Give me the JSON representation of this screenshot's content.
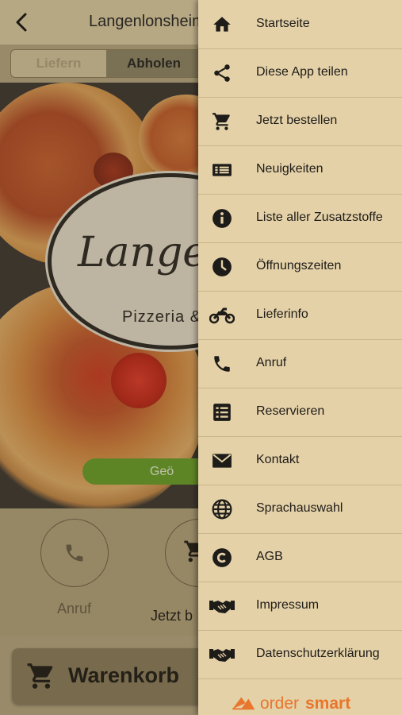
{
  "header": {
    "title": "Langenlonsheim"
  },
  "segment": {
    "deliver_label": "Liefern",
    "pickup_label": "Abholen"
  },
  "hero": {
    "logo_script": "Langen",
    "logo_subtitle": "Pizzeria &",
    "open_button_label": "Geö"
  },
  "actions": {
    "call_label": "Anruf",
    "order_label": "Jetzt b"
  },
  "cart": {
    "label": "Warenkorb"
  },
  "menu": {
    "items": [
      {
        "label": "Startseite",
        "icon": "home-icon"
      },
      {
        "label": "Diese App teilen",
        "icon": "share-icon"
      },
      {
        "label": "Jetzt bestellen",
        "icon": "cart-icon"
      },
      {
        "label": "Neuigkeiten",
        "icon": "news-icon"
      },
      {
        "label": "Liste aller Zusatzstoffe",
        "icon": "info-icon"
      },
      {
        "label": "Öffnungszeiten",
        "icon": "clock-icon"
      },
      {
        "label": "Lieferinfo",
        "icon": "motorbike-icon"
      },
      {
        "label": "Anruf",
        "icon": "phone-icon"
      },
      {
        "label": "Reservieren",
        "icon": "list-icon"
      },
      {
        "label": "Kontakt",
        "icon": "envelope-icon"
      },
      {
        "label": "Sprachauswahl",
        "icon": "globe-icon"
      },
      {
        "label": "AGB",
        "icon": "copyright-icon"
      },
      {
        "label": "Impressum",
        "icon": "handshake-icon"
      },
      {
        "label": "Datenschutzerklärung",
        "icon": "handshake-icon"
      }
    ]
  },
  "footer": {
    "brand_part1": "order",
    "brand_part2": "smart"
  },
  "colors": {
    "drawer_bg": "#e4d1a8",
    "accent_green": "#6aa027",
    "brand_orange": "#e8762d"
  }
}
